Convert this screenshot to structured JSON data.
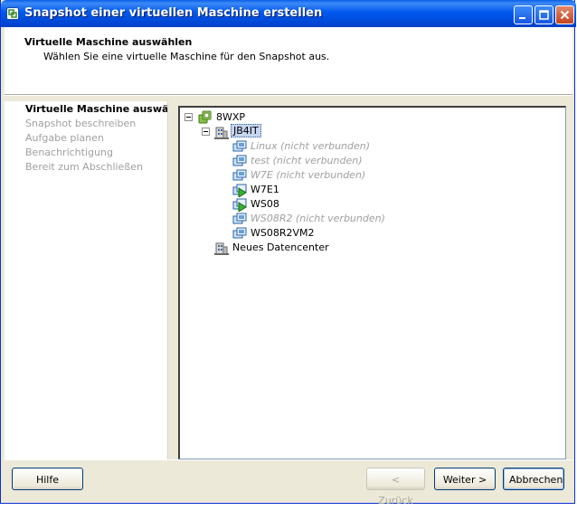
{
  "window": {
    "title": "Snapshot einer virtuellen Maschine erstellen"
  },
  "header": {
    "title": "Virtuelle Maschine auswählen",
    "subtitle": "Wählen Sie eine virtuelle Maschine für den Snapshot aus."
  },
  "steps": [
    {
      "label": "Virtuelle Maschine auswählen",
      "active": true
    },
    {
      "label": "Snapshot beschreiben",
      "active": false
    },
    {
      "label": "Aufgabe planen",
      "active": false
    },
    {
      "label": "Benachrichtigung",
      "active": false
    },
    {
      "label": "Bereit zum Abschließen",
      "active": false
    }
  ],
  "tree": {
    "root": {
      "label": "8WXP",
      "icon": "vcenter-icon"
    },
    "datacenter": {
      "label": "JB4IT",
      "icon": "datacenter-icon"
    },
    "vms": [
      {
        "label": "Linux (nicht verbunden)",
        "state": "disconnected",
        "icon": "vm-icon"
      },
      {
        "label": "test (nicht verbunden)",
        "state": "disconnected",
        "icon": "vm-icon"
      },
      {
        "label": "W7E (nicht verbunden)",
        "state": "disconnected",
        "icon": "vm-icon"
      },
      {
        "label": "W7E1",
        "state": "running",
        "icon": "vm-running-icon"
      },
      {
        "label": "WS08",
        "state": "running",
        "icon": "vm-running-icon"
      },
      {
        "label": "WS08R2 (nicht verbunden)",
        "state": "disconnected",
        "icon": "vm-icon"
      },
      {
        "label": "WS08R2VM2",
        "state": "off",
        "icon": "vm-icon"
      }
    ],
    "other_datacenter": {
      "label": "Neues Datencenter",
      "icon": "datacenter-icon"
    }
  },
  "buttons": {
    "help": "Hilfe",
    "back": "< Zurück",
    "next": "Weiter >",
    "cancel": "Abbrechen"
  },
  "colors": {
    "titlebar": "#0058ee",
    "disabled_text": "#a0a0a0",
    "selection": "#c6d6f0"
  }
}
